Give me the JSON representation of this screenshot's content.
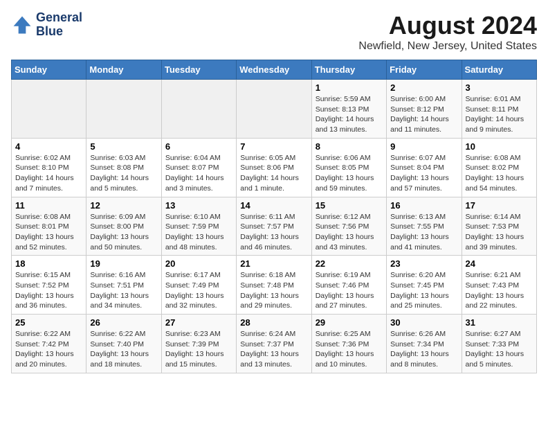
{
  "header": {
    "logo_line1": "General",
    "logo_line2": "Blue",
    "title": "August 2024",
    "subtitle": "Newfield, New Jersey, United States"
  },
  "days_of_week": [
    "Sunday",
    "Monday",
    "Tuesday",
    "Wednesday",
    "Thursday",
    "Friday",
    "Saturday"
  ],
  "weeks": [
    [
      {
        "day": "",
        "info": ""
      },
      {
        "day": "",
        "info": ""
      },
      {
        "day": "",
        "info": ""
      },
      {
        "day": "",
        "info": ""
      },
      {
        "day": "1",
        "info": "Sunrise: 5:59 AM\nSunset: 8:13 PM\nDaylight: 14 hours\nand 13 minutes."
      },
      {
        "day": "2",
        "info": "Sunrise: 6:00 AM\nSunset: 8:12 PM\nDaylight: 14 hours\nand 11 minutes."
      },
      {
        "day": "3",
        "info": "Sunrise: 6:01 AM\nSunset: 8:11 PM\nDaylight: 14 hours\nand 9 minutes."
      }
    ],
    [
      {
        "day": "4",
        "info": "Sunrise: 6:02 AM\nSunset: 8:10 PM\nDaylight: 14 hours\nand 7 minutes."
      },
      {
        "day": "5",
        "info": "Sunrise: 6:03 AM\nSunset: 8:08 PM\nDaylight: 14 hours\nand 5 minutes."
      },
      {
        "day": "6",
        "info": "Sunrise: 6:04 AM\nSunset: 8:07 PM\nDaylight: 14 hours\nand 3 minutes."
      },
      {
        "day": "7",
        "info": "Sunrise: 6:05 AM\nSunset: 8:06 PM\nDaylight: 14 hours\nand 1 minute."
      },
      {
        "day": "8",
        "info": "Sunrise: 6:06 AM\nSunset: 8:05 PM\nDaylight: 13 hours\nand 59 minutes."
      },
      {
        "day": "9",
        "info": "Sunrise: 6:07 AM\nSunset: 8:04 PM\nDaylight: 13 hours\nand 57 minutes."
      },
      {
        "day": "10",
        "info": "Sunrise: 6:08 AM\nSunset: 8:02 PM\nDaylight: 13 hours\nand 54 minutes."
      }
    ],
    [
      {
        "day": "11",
        "info": "Sunrise: 6:08 AM\nSunset: 8:01 PM\nDaylight: 13 hours\nand 52 minutes."
      },
      {
        "day": "12",
        "info": "Sunrise: 6:09 AM\nSunset: 8:00 PM\nDaylight: 13 hours\nand 50 minutes."
      },
      {
        "day": "13",
        "info": "Sunrise: 6:10 AM\nSunset: 7:59 PM\nDaylight: 13 hours\nand 48 minutes."
      },
      {
        "day": "14",
        "info": "Sunrise: 6:11 AM\nSunset: 7:57 PM\nDaylight: 13 hours\nand 46 minutes."
      },
      {
        "day": "15",
        "info": "Sunrise: 6:12 AM\nSunset: 7:56 PM\nDaylight: 13 hours\nand 43 minutes."
      },
      {
        "day": "16",
        "info": "Sunrise: 6:13 AM\nSunset: 7:55 PM\nDaylight: 13 hours\nand 41 minutes."
      },
      {
        "day": "17",
        "info": "Sunrise: 6:14 AM\nSunset: 7:53 PM\nDaylight: 13 hours\nand 39 minutes."
      }
    ],
    [
      {
        "day": "18",
        "info": "Sunrise: 6:15 AM\nSunset: 7:52 PM\nDaylight: 13 hours\nand 36 minutes."
      },
      {
        "day": "19",
        "info": "Sunrise: 6:16 AM\nSunset: 7:51 PM\nDaylight: 13 hours\nand 34 minutes."
      },
      {
        "day": "20",
        "info": "Sunrise: 6:17 AM\nSunset: 7:49 PM\nDaylight: 13 hours\nand 32 minutes."
      },
      {
        "day": "21",
        "info": "Sunrise: 6:18 AM\nSunset: 7:48 PM\nDaylight: 13 hours\nand 29 minutes."
      },
      {
        "day": "22",
        "info": "Sunrise: 6:19 AM\nSunset: 7:46 PM\nDaylight: 13 hours\nand 27 minutes."
      },
      {
        "day": "23",
        "info": "Sunrise: 6:20 AM\nSunset: 7:45 PM\nDaylight: 13 hours\nand 25 minutes."
      },
      {
        "day": "24",
        "info": "Sunrise: 6:21 AM\nSunset: 7:43 PM\nDaylight: 13 hours\nand 22 minutes."
      }
    ],
    [
      {
        "day": "25",
        "info": "Sunrise: 6:22 AM\nSunset: 7:42 PM\nDaylight: 13 hours\nand 20 minutes."
      },
      {
        "day": "26",
        "info": "Sunrise: 6:22 AM\nSunset: 7:40 PM\nDaylight: 13 hours\nand 18 minutes."
      },
      {
        "day": "27",
        "info": "Sunrise: 6:23 AM\nSunset: 7:39 PM\nDaylight: 13 hours\nand 15 minutes."
      },
      {
        "day": "28",
        "info": "Sunrise: 6:24 AM\nSunset: 7:37 PM\nDaylight: 13 hours\nand 13 minutes."
      },
      {
        "day": "29",
        "info": "Sunrise: 6:25 AM\nSunset: 7:36 PM\nDaylight: 13 hours\nand 10 minutes."
      },
      {
        "day": "30",
        "info": "Sunrise: 6:26 AM\nSunset: 7:34 PM\nDaylight: 13 hours\nand 8 minutes."
      },
      {
        "day": "31",
        "info": "Sunrise: 6:27 AM\nSunset: 7:33 PM\nDaylight: 13 hours\nand 5 minutes."
      }
    ]
  ]
}
